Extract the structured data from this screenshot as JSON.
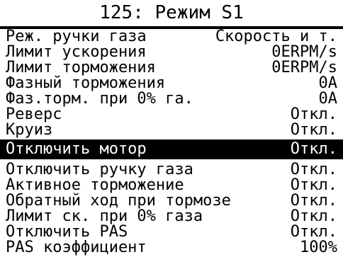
{
  "title": "125: Режим S1",
  "items": [
    {
      "label": "Реж. ручки газа",
      "value": "Скорость и т."
    },
    {
      "label": "Лимит ускорения",
      "value": "0ERPM/s"
    },
    {
      "label": "Лимит торможения",
      "value": "0ERPM/s"
    },
    {
      "label": "Фазный торможения",
      "value": "0A"
    },
    {
      "label": "Фаз.торм. при 0% га.",
      "value": "0A"
    },
    {
      "label": "Реверс",
      "value": "Откл."
    },
    {
      "label": "Круиз",
      "value": "Откл."
    },
    {
      "label": "Отключить мотор",
      "value": "Откл.",
      "selected": true
    },
    {
      "label": "Отключить ручку газа",
      "value": "Откл."
    },
    {
      "label": "Активное торможение",
      "value": "Откл."
    },
    {
      "label": "Обратный ход при тормозе",
      "value": "Откл."
    },
    {
      "label": "Лимит ск. при 0% газа",
      "value": "Откл."
    },
    {
      "label": "Отключить PAS",
      "value": "Откл."
    },
    {
      "label": "PAS коэффициент",
      "value": "100%"
    }
  ]
}
